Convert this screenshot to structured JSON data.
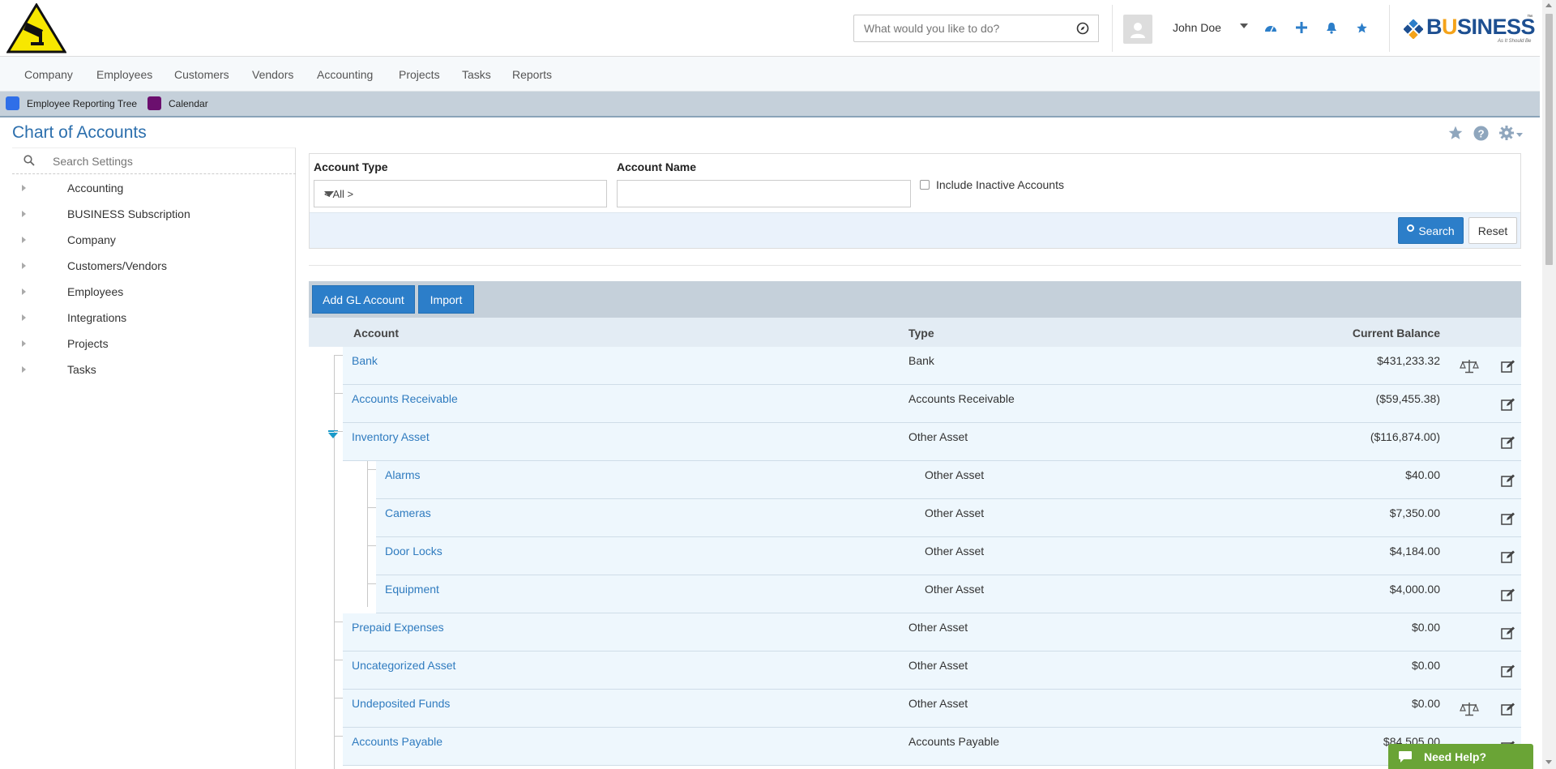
{
  "header": {
    "search_placeholder": "What would you like to do?",
    "user_name": "John Doe",
    "brand_name_pre": "B",
    "brand_name_u": "U",
    "brand_name_post": "SINESS",
    "brand_tagline": "As It Should Be",
    "brand_tm": "™",
    "colors": {
      "accent": "#2c7ec9",
      "brand_blue": "#1d4f91",
      "brand_orange": "#f4a31a",
      "warning_yellow": "#f7e700"
    }
  },
  "nav": [
    "Company",
    "Employees",
    "Customers",
    "Vendors",
    "Accounting",
    "Projects",
    "Tasks",
    "Reports"
  ],
  "favorites": [
    {
      "label": "Employee Reporting Tree",
      "color": "#2f6fe8"
    },
    {
      "label": "Calendar",
      "color": "#6b0f6e"
    }
  ],
  "page": {
    "title": "Chart of Accounts"
  },
  "sidebar": {
    "search_placeholder": "Search Settings",
    "items": [
      "Accounting",
      "BUSINESS Subscription",
      "Company",
      "Customers/Vendors",
      "Employees",
      "Integrations",
      "Projects",
      "Tasks"
    ]
  },
  "filters": {
    "account_type_label": "Account Type",
    "account_type_value": "< All >",
    "account_name_label": "Account Name",
    "account_name_value": "",
    "include_inactive_label": "Include Inactive Accounts",
    "search_button": "Search",
    "reset_button": "Reset"
  },
  "grid": {
    "add_button": "Add GL Account",
    "import_button": "Import",
    "columns": {
      "account": "Account",
      "type": "Type",
      "balance": "Current Balance"
    },
    "rows": [
      {
        "account": "Bank",
        "type": "Bank",
        "balance": "$431,233.32",
        "level": 0,
        "reconcile": true
      },
      {
        "account": "Accounts Receivable",
        "type": "Accounts Receivable",
        "balance": "($59,455.38)",
        "level": 0,
        "reconcile": false
      },
      {
        "account": "Inventory Asset",
        "type": "Other Asset",
        "balance": "($116,874.00)",
        "level": 0,
        "reconcile": false,
        "expanded": true
      },
      {
        "account": "Alarms",
        "type": "Other Asset",
        "balance": "$40.00",
        "level": 1,
        "reconcile": false
      },
      {
        "account": "Cameras",
        "type": "Other Asset",
        "balance": "$7,350.00",
        "level": 1,
        "reconcile": false
      },
      {
        "account": "Door Locks",
        "type": "Other Asset",
        "balance": "$4,184.00",
        "level": 1,
        "reconcile": false
      },
      {
        "account": "Equipment",
        "type": "Other Asset",
        "balance": "$4,000.00",
        "level": 1,
        "reconcile": false
      },
      {
        "account": "Prepaid Expenses",
        "type": "Other Asset",
        "balance": "$0.00",
        "level": 0,
        "reconcile": false
      },
      {
        "account": "Uncategorized Asset",
        "type": "Other Asset",
        "balance": "$0.00",
        "level": 0,
        "reconcile": false
      },
      {
        "account": "Undeposited Funds",
        "type": "Other Asset",
        "balance": "$0.00",
        "level": 0,
        "reconcile": true
      },
      {
        "account": "Accounts Payable",
        "type": "Accounts Payable",
        "balance": "$84,505.00",
        "level": 0,
        "reconcile": false
      }
    ]
  },
  "help_widget": {
    "label": "Need Help?"
  }
}
